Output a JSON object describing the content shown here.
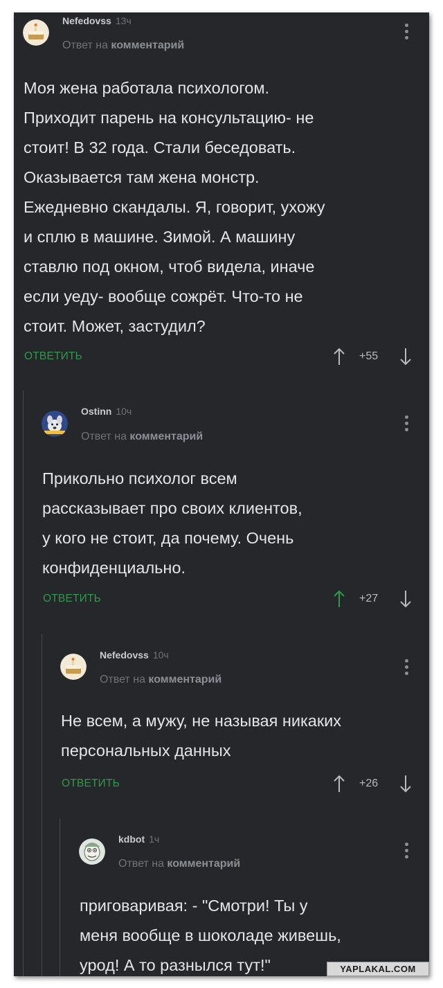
{
  "colors": {
    "background": "#25272a",
    "accent_green": "#2e9a4b",
    "text": "#e3e5e8",
    "muted": "#6f737a"
  },
  "comments": [
    {
      "author": "Nefedovss",
      "time": "13ч",
      "reply_prefix": "Ответ на",
      "reply_target": "комментарий",
      "lines": [
        "Моя жена работала психологом.",
        "Приходит парень на консультацию- не",
        "стоит! В 32 года. Стали беседовать.",
        "Оказывается там жена монстр.",
        "Ежедневно скандалы. Я, говорит, ухожу",
        "и сплю в машине. Зимой. А машину",
        "ставлю под окном, чтоб видела, иначе",
        "если уеду- вообще сожрёт. Что-то не",
        "стоит. Может, застудил?"
      ],
      "reply_label": "ОТВЕТИТЬ",
      "score": "+55",
      "upvote_active": false,
      "avatar_icon": "cake-avatar-icon"
    },
    {
      "author": "Ostinn",
      "time": "10ч",
      "reply_prefix": "Ответ на",
      "reply_target": "комментарий",
      "lines": [
        "Прикольно психолог всем",
        "рассказывает про своих клиентов,",
        "у кого не стоит, да почему. Очень",
        "конфиденциально."
      ],
      "reply_label": "ОТВЕТИТЬ",
      "score": "+27",
      "upvote_active": true,
      "avatar_icon": "dog-avatar-icon"
    },
    {
      "author": "Nefedovss",
      "time": "10ч",
      "reply_prefix": "Ответ на",
      "reply_target": "комментарий",
      "lines": [
        "Не всем, а мужу, не называя никаких",
        "персональных данных"
      ],
      "reply_label": "ОТВЕТИТЬ",
      "score": "+26",
      "upvote_active": false,
      "avatar_icon": "cake-avatar-icon"
    },
    {
      "author": "kdbot",
      "time": "1ч",
      "reply_prefix": "Ответ на",
      "reply_target": "комментарий",
      "lines": [
        "приговаривая: - \"Смотри! Ты у",
        "меня вообще в шоколаде живешь,",
        "урод! А то разнылся тут!\""
      ],
      "avatar_icon": "cartoon-avatar-icon"
    }
  ],
  "watermark": "YAPLAKAL.COM"
}
